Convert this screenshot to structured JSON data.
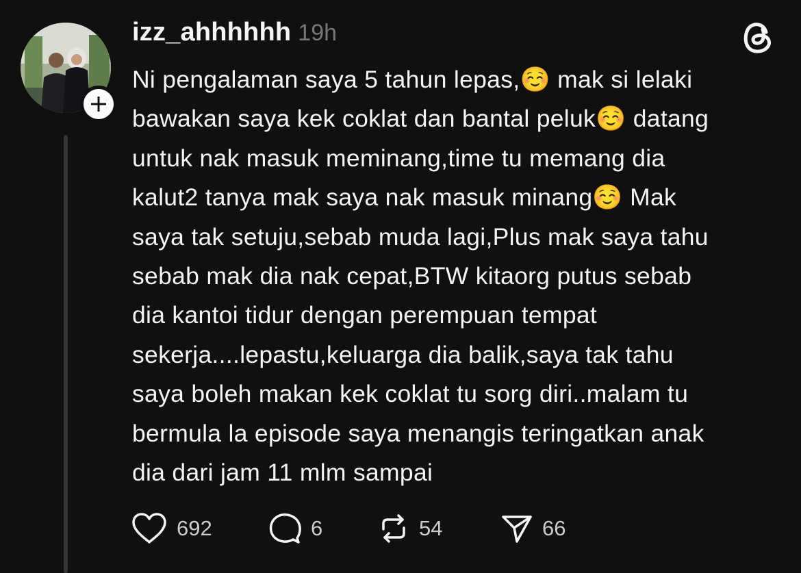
{
  "post": {
    "username": "izz_ahhhhhh",
    "timestamp": "19h",
    "text_lines": [
      "Ni pengalaman saya 5 tahun lepas,☺️ mak si lelaki",
      "bawakan saya kek coklat dan bantal peluk☺️ datang",
      "untuk nak masuk meminang,time tu memang dia",
      "kalut2 tanya mak saya nak masuk minang☺️ Mak",
      "saya tak setuju,sebab muda lagi,Plus mak saya tahu",
      "sebab mak dia nak cepat,BTW kitaorg putus sebab",
      "dia kantoi tidur dengan perempuan tempat",
      "sekerja....lepastu,keluarga dia balik,saya tak tahu",
      "saya boleh makan kek coklat tu sorg diri..malam tu",
      "bermula la episode saya menangis teringatkan anak",
      "dia dari jam 11 mlm sampai"
    ],
    "actions": {
      "likes": "692",
      "replies": "6",
      "reposts": "54",
      "shares": "66"
    }
  },
  "icons": {
    "follow": "plus-icon",
    "app": "threads-logo-icon",
    "like": "heart-icon",
    "reply": "comment-icon",
    "repost": "repost-icon",
    "share": "send-icon"
  },
  "colors": {
    "background": "#101010",
    "text": "#f3f5f7",
    "muted": "#777777",
    "thread_line": "#333638"
  }
}
